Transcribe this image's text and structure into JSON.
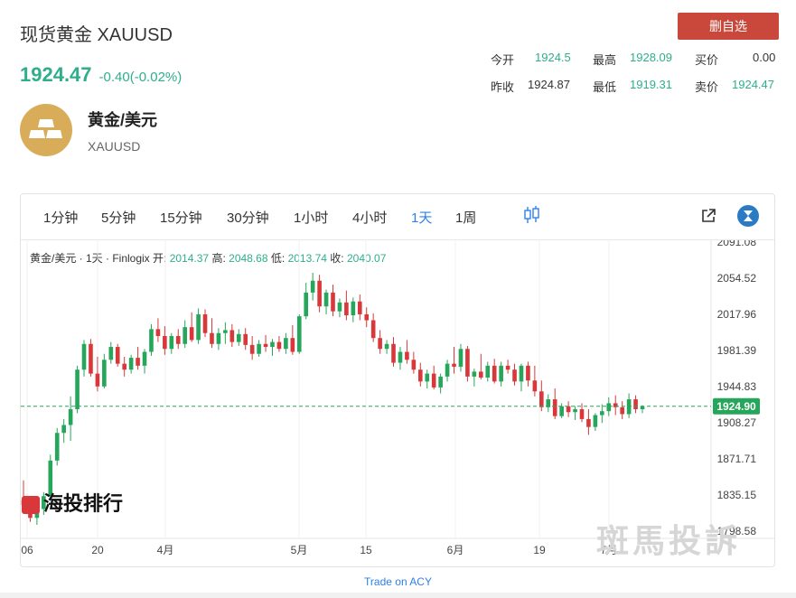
{
  "header": {
    "title": "现货黄金 XAUUSD",
    "price": "1924.47",
    "change": "-0.40(-0.02%)",
    "delete_label": "删自选"
  },
  "quote": {
    "open_label": "今开",
    "open": "1924.5",
    "high_label": "最高",
    "high": "1928.09",
    "bid_label": "买价",
    "bid": "0.00",
    "prev_close_label": "昨收",
    "prev_close": "1924.87",
    "low_label": "最低",
    "low": "1919.31",
    "ask_label": "卖价",
    "ask": "1924.47"
  },
  "instrument": {
    "name": "黄金/美元",
    "symbol": "XAUUSD"
  },
  "toolbar": {
    "timeframes": [
      "1分钟",
      "5分钟",
      "15分钟",
      "30分钟",
      "1小时",
      "4小时",
      "1天",
      "1周"
    ],
    "active_index": 6
  },
  "legend": {
    "title": "黄金/美元 · 1天 · Finlogix",
    "open_label": "开:",
    "open": "2014.37",
    "high_label": "高:",
    "high": "2048.68",
    "low_label": "低:",
    "low": "2013.74",
    "close_label": "收:",
    "close": "2040.07"
  },
  "chart_data": {
    "type": "candlestick",
    "y_ticks": [
      "2091.08",
      "2054.52",
      "2017.96",
      "1981.39",
      "1944.83",
      "1908.27",
      "1871.71",
      "1835.15",
      "1798.58"
    ],
    "ylim": [
      1798.58,
      2091.08
    ],
    "x_ticks": [
      "06",
      "20",
      "4月",
      "5月",
      "15",
      "6月",
      "19",
      "7月"
    ],
    "current_price": "1924.90",
    "colors": {
      "up": "#26a65b",
      "down": "#d9383a",
      "current_line": "#26a65b"
    },
    "candles": [
      [
        1830,
        1850,
        1822,
        1825
      ],
      [
        1825,
        1832,
        1808,
        1812
      ],
      [
        1812,
        1826,
        1805,
        1821
      ],
      [
        1821,
        1838,
        1815,
        1834
      ],
      [
        1834,
        1876,
        1830,
        1870
      ],
      [
        1870,
        1903,
        1865,
        1898
      ],
      [
        1898,
        1912,
        1888,
        1906
      ],
      [
        1906,
        1935,
        1890,
        1922
      ],
      [
        1922,
        1966,
        1918,
        1962
      ],
      [
        1962,
        1992,
        1955,
        1988
      ],
      [
        1988,
        1993,
        1955,
        1958
      ],
      [
        1958,
        1975,
        1940,
        1945
      ],
      [
        1945,
        1978,
        1943,
        1972
      ],
      [
        1972,
        1990,
        1968,
        1985
      ],
      [
        1985,
        1988,
        1965,
        1968
      ],
      [
        1968,
        1975,
        1955,
        1962
      ],
      [
        1962,
        1977,
        1958,
        1974
      ],
      [
        1974,
        1985,
        1962,
        1966
      ],
      [
        1966,
        1983,
        1958,
        1980
      ],
      [
        1980,
        2008,
        1976,
        2003
      ],
      [
        2003,
        2014,
        1990,
        1996
      ],
      [
        1996,
        2006,
        1977,
        1983
      ],
      [
        1983,
        1999,
        1978,
        1996
      ],
      [
        1996,
        2003,
        1983,
        1988
      ],
      [
        1988,
        2012,
        1984,
        2005
      ],
      [
        2005,
        2020,
        1990,
        1992
      ],
      [
        1992,
        2024,
        1988,
        2018
      ],
      [
        2018,
        2023,
        1995,
        1999
      ],
      [
        1999,
        2014,
        1984,
        1988
      ],
      [
        1988,
        2004,
        1982,
        1999
      ],
      [
        1999,
        2010,
        1988,
        2002
      ],
      [
        2002,
        2008,
        1985,
        1990
      ],
      [
        1990,
        2003,
        1986,
        1998
      ],
      [
        1998,
        2004,
        1982,
        1987
      ],
      [
        1987,
        1996,
        1972,
        1978
      ],
      [
        1978,
        1992,
        1975,
        1988
      ],
      [
        1988,
        1997,
        1980,
        1985
      ],
      [
        1985,
        1993,
        1976,
        1990
      ],
      [
        1990,
        1996,
        1980,
        1983
      ],
      [
        1983,
        1999,
        1978,
        1994
      ],
      [
        1994,
        2007,
        1977,
        1980
      ],
      [
        1980,
        2018,
        1978,
        2016
      ],
      [
        2016,
        2050,
        2013,
        2040
      ],
      [
        2040,
        2060,
        2032,
        2052
      ],
      [
        2052,
        2058,
        2020,
        2026
      ],
      [
        2026,
        2043,
        2018,
        2040
      ],
      [
        2040,
        2048,
        2016,
        2021
      ],
      [
        2021,
        2034,
        2015,
        2030
      ],
      [
        2030,
        2042,
        2012,
        2017
      ],
      [
        2017,
        2035,
        2010,
        2031
      ],
      [
        2031,
        2038,
        2012,
        2018
      ],
      [
        2018,
        2025,
        2005,
        2012
      ],
      [
        2012,
        2019,
        1990,
        1994
      ],
      [
        1994,
        2002,
        1978,
        1983
      ],
      [
        1983,
        1992,
        1978,
        1988
      ],
      [
        1988,
        1995,
        1965,
        1969
      ],
      [
        1969,
        1985,
        1962,
        1980
      ],
      [
        1980,
        1992,
        1968,
        1972
      ],
      [
        1972,
        1980,
        1958,
        1962
      ],
      [
        1962,
        1969,
        1945,
        1950
      ],
      [
        1950,
        1962,
        1943,
        1958
      ],
      [
        1958,
        1966,
        1942,
        1944
      ],
      [
        1944,
        1958,
        1938,
        1955
      ],
      [
        1955,
        1972,
        1950,
        1968
      ],
      [
        1968,
        1985,
        1958,
        1965
      ],
      [
        1965,
        1988,
        1960,
        1983
      ],
      [
        1983,
        1986,
        1950,
        1955
      ],
      [
        1955,
        1963,
        1945,
        1960
      ],
      [
        1960,
        1978,
        1952,
        1954
      ],
      [
        1954,
        1970,
        1950,
        1966
      ],
      [
        1966,
        1973,
        1948,
        1950
      ],
      [
        1950,
        1970,
        1945,
        1966
      ],
      [
        1966,
        1972,
        1958,
        1962
      ],
      [
        1962,
        1968,
        1946,
        1950
      ],
      [
        1950,
        1968,
        1940,
        1966
      ],
      [
        1966,
        1970,
        1945,
        1951
      ],
      [
        1951,
        1966,
        1935,
        1940
      ],
      [
        1940,
        1951,
        1920,
        1924
      ],
      [
        1924,
        1937,
        1919,
        1932
      ],
      [
        1932,
        1943,
        1912,
        1915
      ],
      [
        1915,
        1928,
        1913,
        1925
      ],
      [
        1925,
        1930,
        1914,
        1919
      ],
      [
        1919,
        1925,
        1911,
        1922
      ],
      [
        1922,
        1928,
        1909,
        1912
      ],
      [
        1912,
        1922,
        1896,
        1904
      ],
      [
        1904,
        1918,
        1900,
        1916
      ],
      [
        1916,
        1927,
        1908,
        1920
      ],
      [
        1920,
        1934,
        1915,
        1928
      ],
      [
        1928,
        1936,
        1916,
        1924
      ],
      [
        1924,
        1930,
        1912,
        1917
      ],
      [
        1917,
        1938,
        1913,
        1932
      ],
      [
        1932,
        1936,
        1918,
        1922
      ],
      [
        1922,
        1926,
        1918,
        1925
      ]
    ]
  },
  "footer": {
    "link_label": "Trade on ACY",
    "watermark_left": "海投排行",
    "watermark_right": "斑馬投訴"
  }
}
